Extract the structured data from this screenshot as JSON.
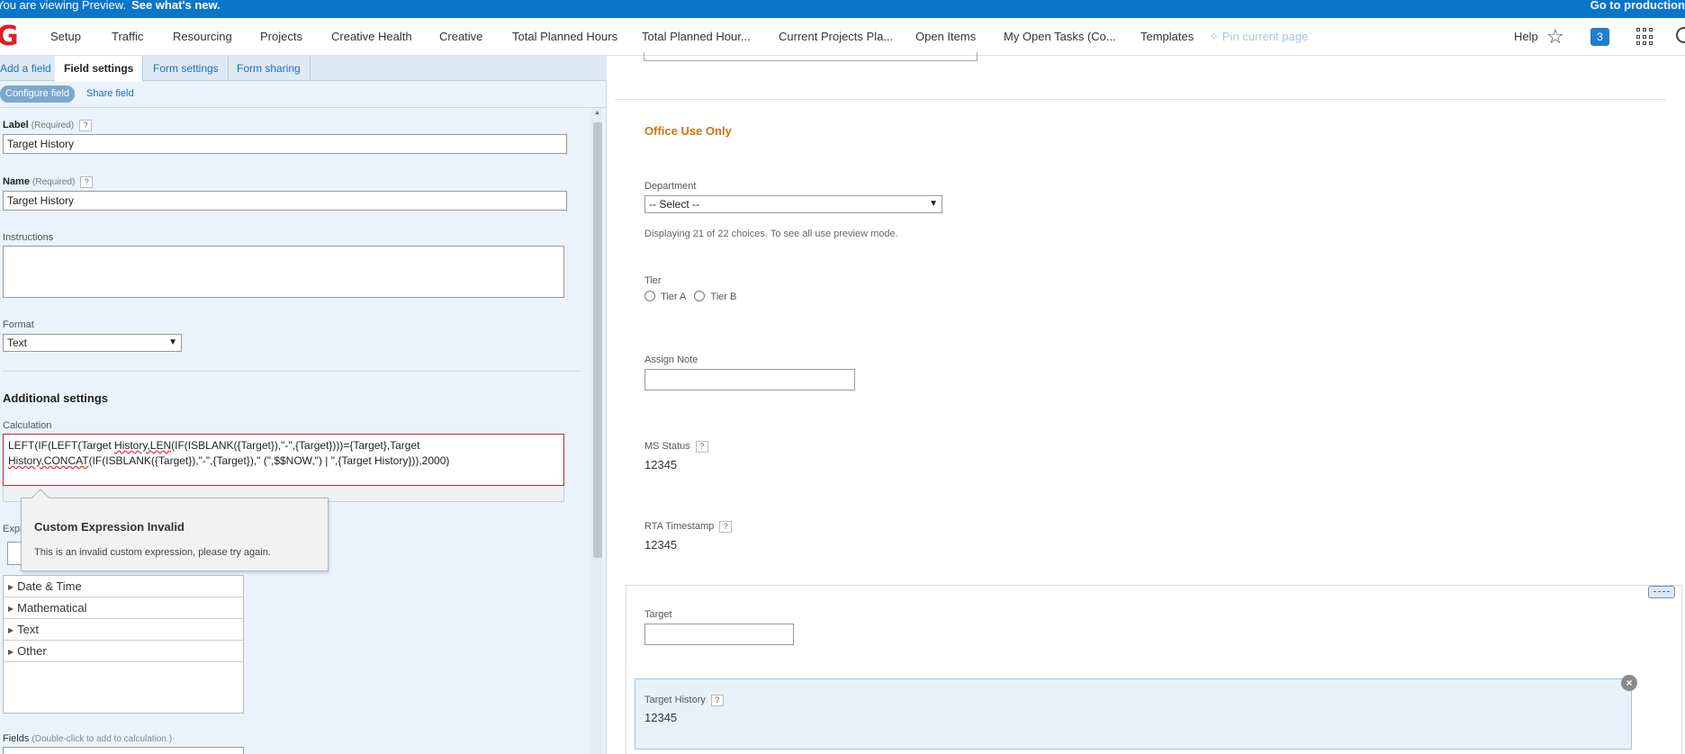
{
  "banner": {
    "message": "You are viewing Preview.",
    "link": "See what's new.",
    "right_link": "Go to production"
  },
  "nav": {
    "logo": "G",
    "items": [
      "Setup",
      "Traffic",
      "Resourcing",
      "Projects",
      "Creative Health",
      "Creative",
      "Total Planned Hours",
      "Total Planned Hour...",
      "Current Projects Pla...",
      "Open Items",
      "My Open Tasks (Co...",
      "Templates"
    ],
    "pin": "Pin current page",
    "help": "Help",
    "badge_count": "3",
    "icons": [
      "star-icon",
      "apps-grid-icon",
      "search-icon"
    ]
  },
  "left": {
    "tabs": [
      "Add a field",
      "Field settings",
      "Form settings",
      "Form sharing"
    ],
    "active_tab": "Field settings",
    "subtabs": {
      "configure": "Configure field",
      "share": "Share field"
    },
    "label": {
      "title": "Label",
      "req": "(Required)",
      "value": "Target History"
    },
    "name": {
      "title": "Name",
      "req": "(Required)",
      "value": "Target History"
    },
    "instructions": {
      "title": "Instructions",
      "value": ""
    },
    "format": {
      "title": "Format",
      "value": "Text"
    },
    "additional": "Additional settings",
    "calc": {
      "title": "Calculation",
      "line1_a": "LEFT(IF(LEFT(Target ",
      "line1_b": "History,LEN",
      "line1_c": "(IF(ISBLANK({Target}),\"-\",{Target})))={Target},Target",
      "line2_a": "History,CONCAT",
      "line2_b": "(IF(ISBLANK({Target}),\"-\",{Target}),\" (\",$$NOW,\") | \",{Target History})),2000)"
    },
    "tooltip": {
      "title": "Custom Expression Invalid",
      "body": "This is an invalid custom expression, please try again."
    },
    "expr_label": "Expr",
    "expr_items": [
      "Date & Time",
      "Mathematical",
      "Text",
      "Other"
    ],
    "fields": {
      "title": "Fields",
      "hint": "(Double-click to add to calculation.)"
    }
  },
  "right": {
    "office": "Office Use Only",
    "department": {
      "label": "Department",
      "value": "-- Select --",
      "note": "Displaying 21 of 22 choices. To see all use preview mode."
    },
    "tier": {
      "label": "Tier",
      "options": [
        "Tier A",
        "Tier B"
      ]
    },
    "assign_note": {
      "label": "Assign Note"
    },
    "ms_status": {
      "label": "MS Status",
      "value": "12345"
    },
    "rta": {
      "label": "RTA Timestamp",
      "value": "12345"
    },
    "target": {
      "label": "Target"
    },
    "target_history": {
      "label": "Target History",
      "value": "12345"
    }
  },
  "colors": {
    "banner": "#0b75c9",
    "logo": "#e11d27",
    "office_use": "#d07212",
    "error_border": "#c1272d",
    "badge": "#1e7fd0"
  }
}
